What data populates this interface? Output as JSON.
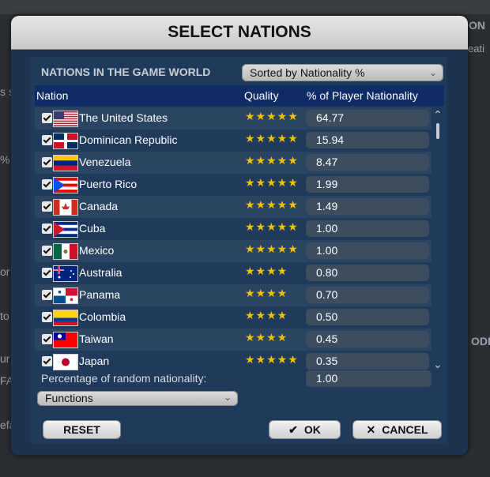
{
  "background": {
    "fragments": [
      "ON",
      "eati",
      "s s",
      "%",
      "or",
      "to",
      "ur",
      "FA",
      "efa",
      "ODI"
    ]
  },
  "dialog": {
    "title": "SELECT NATIONS",
    "section_label": "NATIONS IN THE GAME WORLD",
    "sort_dropdown": {
      "value": "Sorted by Nationality %",
      "icon": "chevron-down-icon"
    },
    "columns": [
      "Nation",
      "Quality",
      "% of Player Nationality"
    ],
    "rows": [
      {
        "name": "The United States",
        "flag": "us-flag-icon",
        "stars": "★★★★★",
        "pct": "64.77",
        "checked": true
      },
      {
        "name": "Dominican Republic",
        "flag": "dominican-republic-flag-icon",
        "stars": "★★★★★",
        "pct": "15.94",
        "checked": true
      },
      {
        "name": "Venezuela",
        "flag": "venezuela-flag-icon",
        "stars": "★★★★★",
        "pct": "8.47",
        "checked": true
      },
      {
        "name": "Puerto Rico",
        "flag": "puerto-rico-flag-icon",
        "stars": "★★★★★",
        "pct": "1.99",
        "checked": true
      },
      {
        "name": "Canada",
        "flag": "canada-flag-icon",
        "stars": "★★★★★",
        "pct": "1.49",
        "checked": true
      },
      {
        "name": "Cuba",
        "flag": "cuba-flag-icon",
        "stars": "★★★★★",
        "pct": "1.00",
        "checked": true
      },
      {
        "name": "Mexico",
        "flag": "mexico-flag-icon",
        "stars": "★★★★★",
        "pct": "1.00",
        "checked": true
      },
      {
        "name": "Australia",
        "flag": "australia-flag-icon",
        "stars": "★★★★",
        "pct": "0.80",
        "checked": true
      },
      {
        "name": "Panama",
        "flag": "panama-flag-icon",
        "stars": "★★★★",
        "pct": "0.70",
        "checked": true
      },
      {
        "name": "Colombia",
        "flag": "colombia-flag-icon",
        "stars": "★★★★",
        "pct": "0.50",
        "checked": true
      },
      {
        "name": "Taiwan",
        "flag": "taiwan-flag-icon",
        "stars": "★★★★",
        "pct": "0.45",
        "checked": true
      },
      {
        "name": "Japan",
        "flag": "japan-flag-icon",
        "stars": "★★★★★",
        "pct": "0.35",
        "checked": true
      }
    ],
    "random_label": "Percentage of random nationality:",
    "random_value": "1.00",
    "functions_dropdown": {
      "value": "Functions",
      "icon": "chevron-down-icon"
    },
    "buttons": {
      "reset": "RESET",
      "ok": "OK",
      "cancel": "CANCEL"
    },
    "colors": {
      "accent_header": "#0f2c66",
      "panel": "#1f3a5a",
      "star": "#f2c200"
    }
  }
}
